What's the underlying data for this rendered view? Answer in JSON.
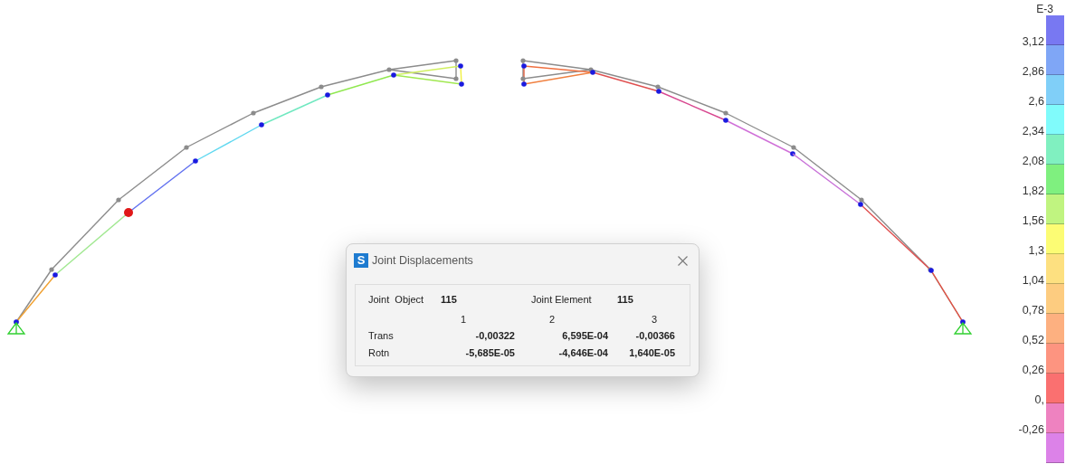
{
  "dialog": {
    "title": "Joint Displacements",
    "app_icon": "S",
    "joint_object": {
      "label": "Joint  Object",
      "value": "115"
    },
    "joint_element": {
      "label": "Joint Element",
      "value": "115"
    },
    "columns": [
      "1",
      "2",
      "3"
    ],
    "rows": [
      {
        "label": "Trans",
        "values": [
          "-0,00322",
          "6,595E-04",
          "-0,00366"
        ]
      },
      {
        "label": "Rotn",
        "values": [
          "-5,685E-05",
          "-4,646E-04",
          "1,640E-05"
        ]
      }
    ]
  },
  "legend": {
    "unit": "E-3",
    "labels": [
      "3,12",
      "2,86",
      "2,6",
      "2,34",
      "2,08",
      "1,82",
      "1,56",
      "1,3",
      "1,04",
      "0,78",
      "0,52",
      "0,26",
      "0,",
      "-0,26"
    ],
    "bands": [
      {
        "color": "#7878f2"
      },
      {
        "color": "#7fa6f6"
      },
      {
        "color": "#80cff8"
      },
      {
        "color": "#80fbfb"
      },
      {
        "color": "#80f0c0"
      },
      {
        "color": "#7ff07f"
      },
      {
        "color": "#c0f480"
      },
      {
        "color": "#fcfc74"
      },
      {
        "color": "#fde080"
      },
      {
        "color": "#fdcc80"
      },
      {
        "color": "#fdb080"
      },
      {
        "color": "#fd9480"
      },
      {
        "color": "#fa7070"
      },
      {
        "color": "#ee82c0"
      },
      {
        "color": "#dc82e8"
      }
    ]
  }
}
